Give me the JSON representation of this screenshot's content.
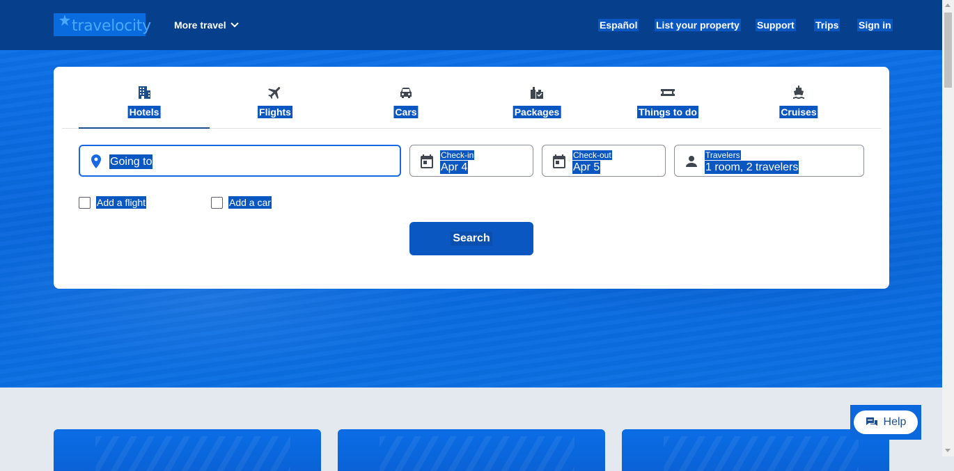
{
  "header": {
    "logo_text": "travelocity",
    "more_travel": "More travel",
    "links": [
      "Español",
      "List your property",
      "Support",
      "Trips",
      "Sign in"
    ]
  },
  "search": {
    "tabs": [
      {
        "label": "Hotels",
        "icon": "hotel-icon"
      },
      {
        "label": "Flights",
        "icon": "plane-icon"
      },
      {
        "label": "Cars",
        "icon": "car-icon"
      },
      {
        "label": "Packages",
        "icon": "packages-icon"
      },
      {
        "label": "Things to do",
        "icon": "ticket-icon"
      },
      {
        "label": "Cruises",
        "icon": "cruise-icon"
      }
    ],
    "going_to_placeholder": "Going to",
    "checkin_label": "Check-in",
    "checkin_value": "Apr 4",
    "checkout_label": "Check-out",
    "checkout_value": "Apr 5",
    "travelers_label": "Travelers",
    "travelers_value": "1 room, 2 travelers",
    "add_flight": "Add a flight",
    "add_car": "Add a car",
    "search_button": "Search"
  },
  "help_label": "Help",
  "colors": {
    "header_bg": "#063f8c",
    "hero_bg": "#0a68dc",
    "accent": "#0a57c2",
    "text_dark": "#1c4e8f"
  }
}
